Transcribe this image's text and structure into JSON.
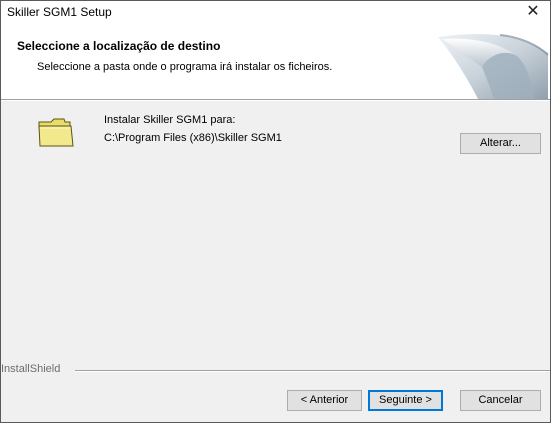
{
  "window": {
    "title": "Skiller SGM1 Setup",
    "close_glyph": "✕"
  },
  "header": {
    "heading": "Seleccione a localização de destino",
    "subtitle": "Seleccione a pasta onde o programa irá instalar os ficheiros."
  },
  "destination": {
    "label": "Instalar Skiller SGM1 para:",
    "path": "C:\\Program Files (x86)\\Skiller SGM1",
    "change_button": "Alterar..."
  },
  "footer": {
    "brand": "InstallShield",
    "back_button": "< Anterior",
    "next_button": "Seguinte >",
    "cancel_button": "Cancelar"
  },
  "icons": {
    "folder": "folder-icon",
    "close": "close-icon"
  },
  "colors": {
    "folder_fill": "#f2e88c",
    "default_button_border": "#0078d7"
  }
}
